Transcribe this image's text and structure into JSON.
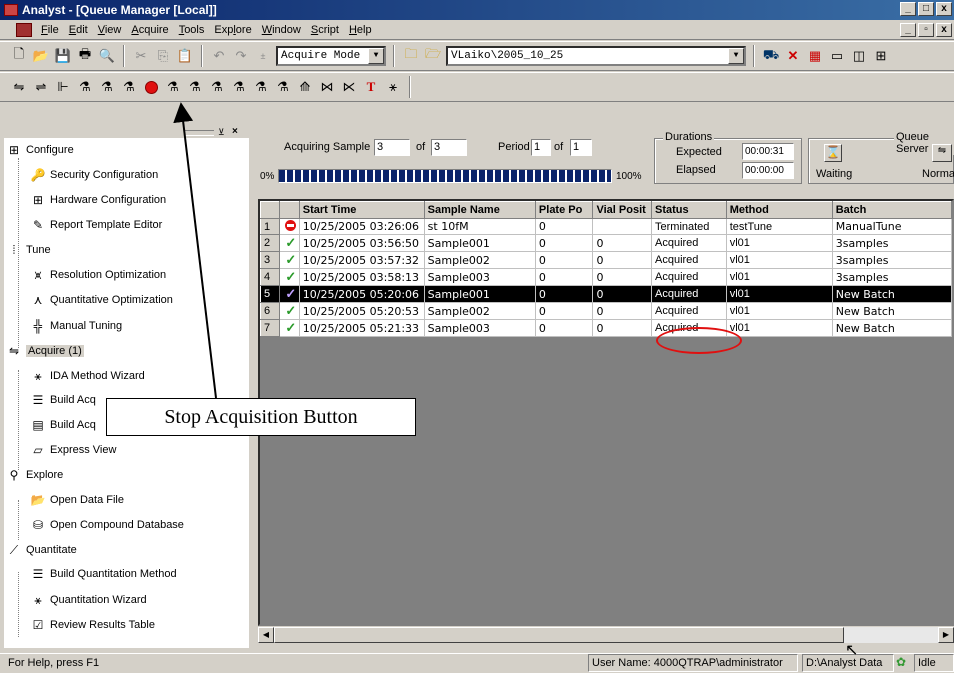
{
  "window": {
    "title": "Analyst - [Queue Manager [Local]]"
  },
  "menu": [
    {
      "pre": "",
      "u": "F",
      "post": "ile"
    },
    {
      "pre": "",
      "u": "E",
      "post": "dit"
    },
    {
      "pre": "",
      "u": "V",
      "post": "iew"
    },
    {
      "pre": "",
      "u": "A",
      "post": "cquire"
    },
    {
      "pre": "",
      "u": "T",
      "post": "ools"
    },
    {
      "pre": "Exp",
      "u": "l",
      "post": "ore"
    },
    {
      "pre": "",
      "u": "W",
      "post": "indow"
    },
    {
      "pre": "",
      "u": "S",
      "post": "cript"
    },
    {
      "pre": "",
      "u": "H",
      "post": "elp"
    }
  ],
  "toolbar": {
    "mode_value": "Acquire Mode",
    "path_value": "VLaiko\\2005_10_25"
  },
  "sidebar": {
    "items": [
      {
        "label": "Configure",
        "icon": "configure-icon",
        "level": 0
      },
      {
        "label": "Security Configuration",
        "icon": "key-icon",
        "level": 1
      },
      {
        "label": "Hardware Configuration",
        "icon": "hardware-icon",
        "level": 1
      },
      {
        "label": "Report Template Editor",
        "icon": "report-icon",
        "level": 1
      },
      {
        "label": "Tune",
        "icon": "tune-icon",
        "level": 0
      },
      {
        "label": "Resolution Optimization",
        "icon": "resolution-icon",
        "level": 1
      },
      {
        "label": "Quantitative Optimization",
        "icon": "quant-opt-icon",
        "level": 1
      },
      {
        "label": "Manual Tuning",
        "icon": "manual-tuning-icon",
        "level": 1
      },
      {
        "label": "Acquire (1)",
        "icon": "acquire-icon",
        "level": 0
      },
      {
        "label": "IDA Method Wizard",
        "icon": "wand-icon",
        "level": 1
      },
      {
        "label": "Build Acq",
        "icon": "build-acq-icon",
        "level": 1
      },
      {
        "label": "Build Acq",
        "icon": "build-acq-batch-icon",
        "level": 1
      },
      {
        "label": "Express View",
        "icon": "express-view-icon",
        "level": 1
      },
      {
        "label": "Explore",
        "icon": "explore-icon",
        "level": 0
      },
      {
        "label": "Open Data File",
        "icon": "folder-open-icon",
        "level": 1
      },
      {
        "label": "Open Compound Database",
        "icon": "database-icon",
        "level": 1
      },
      {
        "label": "Quantitate",
        "icon": "quantitate-icon",
        "level": 0
      },
      {
        "label": "Build Quantitation Method",
        "icon": "quant-method-icon",
        "level": 1
      },
      {
        "label": "Quantitation Wizard",
        "icon": "wand-icon",
        "level": 1
      },
      {
        "label": "Review Results Table",
        "icon": "results-table-icon",
        "level": 1
      }
    ]
  },
  "acq": {
    "acquiring_label": "Acquiring Sample",
    "sample_current": "3",
    "of_label": "of",
    "sample_total": "3",
    "period_label": "Period",
    "period_current": "1",
    "period_total": "1",
    "progress_start": "0%",
    "progress_end": "100%",
    "progress_fraction": 1.0,
    "durations_label": "Durations",
    "expected_label": "Expected",
    "expected_value": "00:00:31",
    "elapsed_label": "Elapsed",
    "elapsed_value": "00:00:00",
    "queue_server_label": "Queue Server",
    "waiting_label": "Waiting",
    "normal_label": "Norma"
  },
  "table": {
    "columns": [
      "",
      "",
      "Start Time",
      "Sample Name",
      "Plate Po",
      "Vial Posit",
      "Status",
      "Method",
      "Batch"
    ],
    "rows": [
      {
        "n": "1",
        "icon": "stop",
        "start": "10/25/2005 03:26:06",
        "sample": "st 10fM",
        "plate": "0",
        "vial": "",
        "status": "Terminated",
        "method": "testTune",
        "batch": "ManualTune"
      },
      {
        "n": "2",
        "icon": "check",
        "start": "10/25/2005 03:56:50",
        "sample": "Sample001",
        "plate": "0",
        "vial": "0",
        "status": "Acquired",
        "method": "vl01",
        "batch": "3samples"
      },
      {
        "n": "3",
        "icon": "check",
        "start": "10/25/2005 03:57:32",
        "sample": "Sample002",
        "plate": "0",
        "vial": "0",
        "status": "Acquired",
        "method": "vl01",
        "batch": "3samples"
      },
      {
        "n": "4",
        "icon": "check",
        "start": "10/25/2005 03:58:13",
        "sample": "Sample003",
        "plate": "0",
        "vial": "0",
        "status": "Acquired",
        "method": "vl01",
        "batch": "3samples"
      },
      {
        "n": "5",
        "icon": "check",
        "start": "10/25/2005 05:20:06",
        "sample": "Sample001",
        "plate": "0",
        "vial": "0",
        "status": "Acquired",
        "method": "vl01",
        "batch": "New Batch"
      },
      {
        "n": "6",
        "icon": "check",
        "start": "10/25/2005 05:20:53",
        "sample": "Sample002",
        "plate": "0",
        "vial": "0",
        "status": "Acquired",
        "method": "vl01",
        "batch": "New Batch"
      },
      {
        "n": "7",
        "icon": "check",
        "start": "10/25/2005 05:21:33",
        "sample": "Sample003",
        "plate": "0",
        "vial": "0",
        "status": "Acquired",
        "method": "vl01",
        "batch": "New Batch"
      }
    ]
  },
  "callout": {
    "text": "Stop Acquisition Button"
  },
  "status": {
    "help": "For Help, press F1",
    "user": "User Name: 4000QTRAP\\administrator",
    "data_path": "D:\\Analyst Data",
    "state": "Idle"
  }
}
